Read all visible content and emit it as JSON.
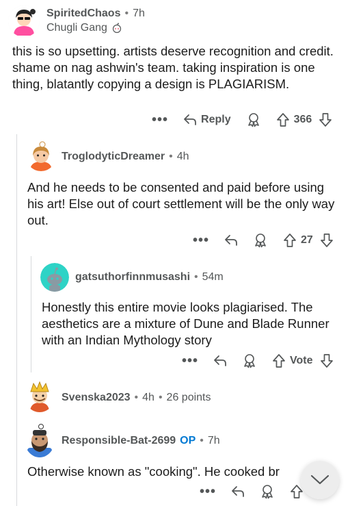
{
  "comments": [
    {
      "username": "SpiritedChaos",
      "time": "7h",
      "flair": "Chugli Gang",
      "flair_icon": "reddit-alien-icon",
      "body": "this is so upsetting. artists deserve recognition and credit. shame on nag ashwin's team. taking inspiration is one thing, blatantly copying a design is PLAGIARISM.",
      "reply_label": "Reply",
      "votes": "366"
    },
    {
      "username": "TroglodyticDreamer",
      "time": "4h",
      "body": "And he needs to be consented and paid before using his art! Else out of court settlement will be the only way out.",
      "votes": "27"
    },
    {
      "username": "gatsuthorfinnmusashi",
      "time": "54m",
      "body": "Honestly this entire movie looks plagiarised. The aesthetics are a mixture of Dune and Blade Runner with an Indian Mythology story",
      "votes": "Vote"
    },
    {
      "username": "Svenska2023",
      "time": "4h",
      "points": "26 points"
    },
    {
      "username": "Responsible-Bat-2699",
      "op_badge": "OP",
      "time": "7h",
      "body": "Otherwise known as \"cooking\". He cooked br"
    }
  ],
  "colors": {
    "teal_avatar": "#2ed3c6",
    "op_blue": "#0079d3",
    "thread_line": "#d7dadc",
    "meta_grey": "#545758"
  },
  "icons": [
    "more-icon",
    "reply-icon",
    "award-icon",
    "upvote-icon",
    "downvote-icon",
    "chevron-down-icon"
  ]
}
